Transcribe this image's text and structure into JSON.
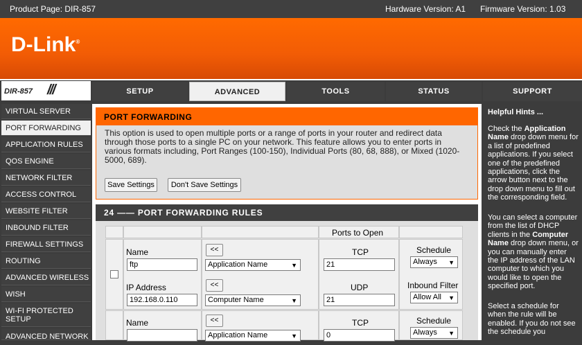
{
  "header": {
    "product_page": "Product Page: DIR-857",
    "hardware_version": "Hardware Version: A1",
    "firmware_version": "Firmware Version: 1.03"
  },
  "brand": {
    "logo": "D-Link",
    "registered_mark": "®",
    "model": "DIR-857",
    "model_slashes": "///"
  },
  "nav": {
    "tabs": [
      {
        "label": "SETUP",
        "active": false
      },
      {
        "label": "ADVANCED",
        "active": true
      },
      {
        "label": "TOOLS",
        "active": false
      },
      {
        "label": "STATUS",
        "active": false
      },
      {
        "label": "SUPPORT",
        "active": false
      }
    ]
  },
  "sidebar": {
    "items": [
      {
        "label": "VIRTUAL SERVER",
        "active": false
      },
      {
        "label": "PORT FORWARDING",
        "active": true
      },
      {
        "label": "APPLICATION RULES",
        "active": false
      },
      {
        "label": "QOS ENGINE",
        "active": false
      },
      {
        "label": "NETWORK FILTER",
        "active": false
      },
      {
        "label": "ACCESS CONTROL",
        "active": false
      },
      {
        "label": "WEBSITE FILTER",
        "active": false
      },
      {
        "label": "INBOUND FILTER",
        "active": false
      },
      {
        "label": "FIREWALL SETTINGS",
        "active": false
      },
      {
        "label": "ROUTING",
        "active": false
      },
      {
        "label": "ADVANCED WIRELESS",
        "active": false
      },
      {
        "label": "WISH",
        "active": false
      },
      {
        "label": "WI-FI PROTECTED SETUP",
        "active": false
      },
      {
        "label": "ADVANCED NETWORK",
        "active": false
      }
    ]
  },
  "port_forwarding": {
    "title": "PORT FORWARDING",
    "description": "This option is used to open multiple ports or a range of ports in your router and redirect data through those ports to a single PC on your network. This feature allows you to enter ports in various formats including, Port Ranges (100-150), Individual Ports (80, 68, 888), or Mixed (1020-5000, 689).",
    "save_label": "Save Settings",
    "dont_save_label": "Don't Save Settings"
  },
  "rules": {
    "title": "24 —— PORT FORWARDING RULES",
    "ports_to_open_header": "Ports to Open",
    "name_label": "Name",
    "ip_label": "IP Address",
    "tcp_label": "TCP",
    "udp_label": "UDP",
    "schedule_label": "Schedule",
    "inbound_label": "Inbound Filter",
    "copy_button": "<<",
    "rows": [
      {
        "name": "ftp",
        "ip": "192.168.0.110",
        "application_select": "Application Name",
        "computer_select": "Computer Name",
        "tcp": "21",
        "udp": "21",
        "schedule": "Always",
        "inbound": "Allow All"
      },
      {
        "name": "",
        "application_select": "Application Name",
        "tcp": "0",
        "schedule": "Always"
      }
    ]
  },
  "hints": {
    "title": "Helpful Hints ...",
    "p1": {
      "a": "Check the ",
      "b": "Application Name",
      "c": " drop down menu for a list of predefined applications. If you select one of the predefined applications, click the arrow button next to the drop down menu to fill out the corresponding field."
    },
    "p2": {
      "a": "You can select a computer from the list of DHCP clients in the ",
      "b": "Computer Name",
      "c": " drop down menu, or you can manually enter the IP address of the LAN computer to which you would like to open the specified port."
    },
    "p3": {
      "a": "Select a schedule for when the rule will be enabled. If you do not see the schedule you"
    }
  }
}
